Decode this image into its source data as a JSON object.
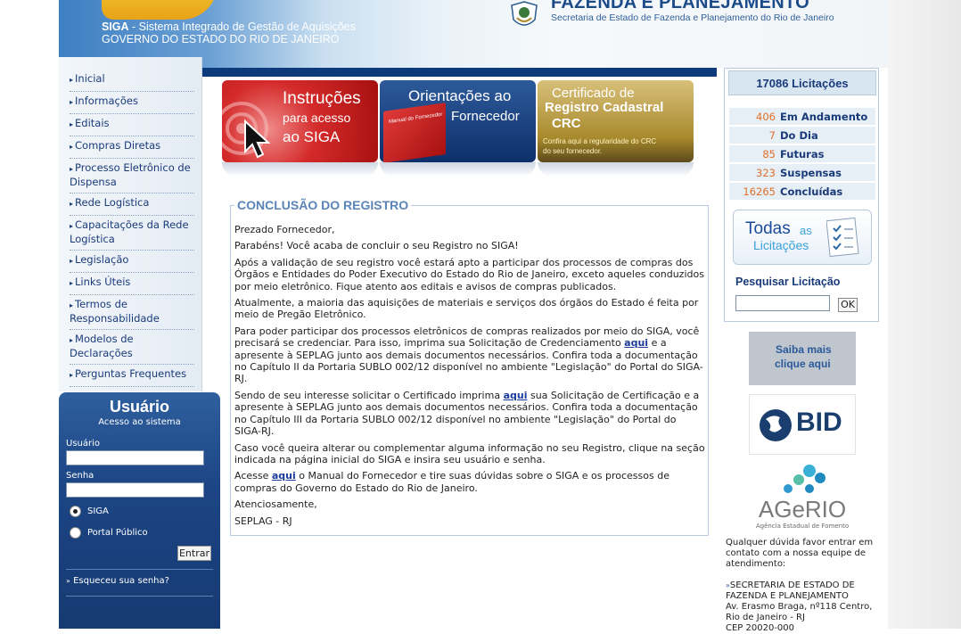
{
  "header": {
    "siga_bold": "SIGA",
    "siga_rest": " - Sistema Integrado de Gestão de Aquisições",
    "gov": "GOVERNO DO ESTADO DO RIO DE JANEIRO",
    "sec_title": "FAZENDA E PLANEJAMENTO",
    "sec_sub": "Secretaria de Estado de Fazenda e Planejamento do Rio de Janeiro"
  },
  "nav": {
    "items": [
      "Inicial",
      "Informações",
      "Editais",
      "Compras Diretas",
      "Processo Eletrônico de Dispensa",
      "Rede Logística",
      "Capacitações da Rede Logística",
      "Legislação",
      "Links Úteis",
      "Termos de Responsabilidade",
      "Modelos de Declarações",
      "Perguntas Frequentes"
    ]
  },
  "login": {
    "title": "Usuário",
    "subtitle": "Acesso ao sistema",
    "user_label": "Usuário",
    "pass_label": "Senha",
    "radio_siga": "SIGA",
    "radio_portal": "Portal Público",
    "submit": "Entrar",
    "forgot": "Esqueceu sua senha?"
  },
  "banners": {
    "b1_line1": "Instruções",
    "b1_line2": "para acesso",
    "b1_line3": "ao SIGA",
    "b2_line1": "Orientações ao",
    "b2_line2": "Fornecedor",
    "b2_book": "Manual do Fornecedor",
    "b3_line1": "Certificado de",
    "b3_line2": "Registro Cadastral",
    "b3_line3": "CRC",
    "b3_line4": "Confira aqui  a regularidade  do CRC",
    "b3_line5": "do seu fornecedor."
  },
  "main": {
    "legend": "CONCLUSÃO DO REGISTRO",
    "p1": "Prezado Fornecedor,",
    "p2": "Parabéns! Você acaba de concluir o seu Registro no SIGA!",
    "p3": "Após a validação de seu registro você estará apto a participar dos processos de compras dos Órgãos e Entidades do Poder Executivo do Estado do Rio de Janeiro, exceto aqueles conduzidos por meio eletrônico. Fique atento aos editais e avisos de compras publicados.",
    "p4": "Atualmente, a maioria das aquisições de materiais e serviços dos órgãos do Estado é feita por meio de Pregão Eletrônico.",
    "p5a": "Para poder participar dos processos eletrônicos de compras realizados por meio do SIGA, você precisará se credenciar. Para isso, imprima sua Solicitação de Credenciamento ",
    "p5link": "aqui",
    "p5b": " e a apresente à SEPLAG junto aos demais documentos necessários. Confira toda a documentação no Capítulo II da Portaria SUBLO 002/12 disponível no ambiente \"Legislação\" do Portal do SIGA-RJ.",
    "p6a": "Sendo de seu interesse solicitar o Certificado imprima ",
    "p6link": "aqui",
    "p6b": " sua Solicitação de Certificação e a apresente à SEPLAG junto aos demais documentos necessários. Confira toda a documentação no Capítulo III da Portaria SUBLO 002/12 disponível no ambiente \"Legislação\" do Portal do SIGA-RJ.",
    "p7": "Caso você queira alterar ou complementar alguma informação no seu Registro, clique na seção indicada na página inicial do SIGA e insira seu usuário e senha.",
    "p8a": "Acesse ",
    "p8link": "aqui",
    "p8b": " o Manual do Fornecedor e tire suas dúvidas sobre o SIGA e os processos de compras do Governo do Estado do Rio de Janeiro.",
    "p9": "Atenciosamente,",
    "p10": "SEPLAG - RJ"
  },
  "right": {
    "total": "17086 Licitações",
    "rows": [
      {
        "n": "406",
        "l": "Em Andamento"
      },
      {
        "n": "7",
        "l": "Do Dia"
      },
      {
        "n": "85",
        "l": "Futuras"
      },
      {
        "n": "323",
        "l": "Suspensas"
      },
      {
        "n": "16265",
        "l": "Concluídas"
      }
    ],
    "todas_1": "Todas",
    "todas_2": "as",
    "todas_3": "Licitações",
    "search_title": "Pesquisar Licitação",
    "ok": "OK",
    "saiba1": "Saiba mais",
    "saiba2": "clique aqui",
    "bid": "BID",
    "agerio": "AGeRIO",
    "agerio_sub": "Agência Estadual de Fomento",
    "contact_intro": "Qualquer dúvida favor entrar em contato com a nossa equipe de atendimento:",
    "contact_org": "SECRETARIA DE ESTADO DE FAZENDA E PLANEJAMENTO",
    "contact_addr1": "Av. Erasmo Braga, nº118 Centro,",
    "contact_addr2": "Rio de Janeiro - RJ",
    "contact_cep": "CEP 20020-000"
  }
}
